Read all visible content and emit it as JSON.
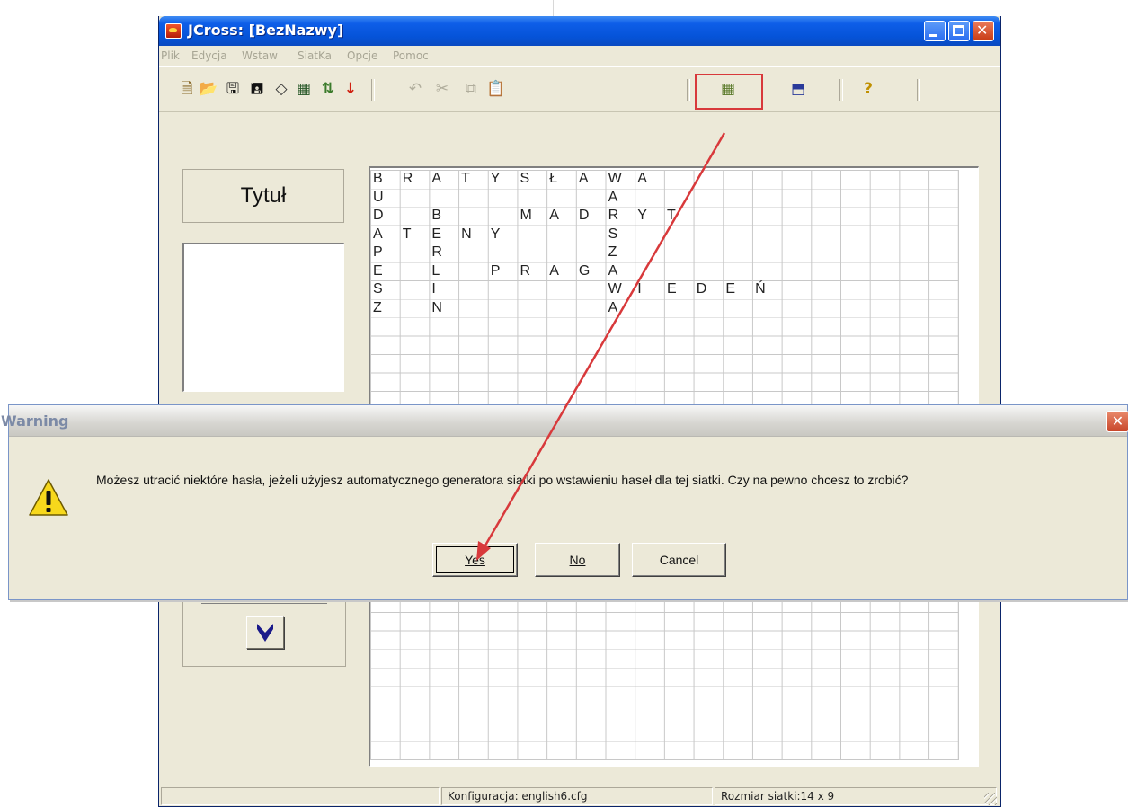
{
  "window": {
    "title": "JCross: [BezNazwy]"
  },
  "menu": {
    "items": [
      "Plik",
      "Edycja",
      "Wstaw",
      "SiatKa",
      "Opcje",
      "Pomoc"
    ]
  },
  "toolbar": {
    "buttons": [
      {
        "name": "new-icon",
        "glyph": "🗎"
      },
      {
        "name": "open-icon",
        "glyph": "📂"
      },
      {
        "name": "save-icon",
        "glyph": "🖫"
      },
      {
        "name": "save-as-icon",
        "glyph": "🖪"
      },
      {
        "name": "eraser-icon",
        "glyph": "◇"
      },
      {
        "name": "pattern-icon",
        "glyph": "▦"
      },
      {
        "name": "sort-icon",
        "glyph": "⇅"
      },
      {
        "name": "down-arrow-icon",
        "glyph": "↓"
      },
      {
        "name": "undo-icon",
        "glyph": "↶"
      },
      {
        "name": "cut-icon",
        "glyph": "✂"
      },
      {
        "name": "copy-icon",
        "glyph": "⧉"
      },
      {
        "name": "paste-icon",
        "glyph": "📋"
      },
      {
        "name": "grid-generator-icon",
        "glyph": "▦"
      },
      {
        "name": "export-icon",
        "glyph": "⬒"
      },
      {
        "name": "help-icon",
        "glyph": "?"
      }
    ]
  },
  "left_panel": {
    "title_label": "Tytuł"
  },
  "grid": {
    "rows": [
      [
        "B",
        "R",
        "A",
        "T",
        "Y",
        "S",
        "Ł",
        "A",
        "W",
        "A",
        "",
        "",
        "",
        "",
        "",
        "",
        "",
        "",
        "",
        ""
      ],
      [
        "U",
        "",
        "",
        "",
        "",
        "",
        "",
        "",
        "A",
        "",
        "",
        "",
        "",
        "",
        "",
        "",
        "",
        "",
        "",
        ""
      ],
      [
        "D",
        "",
        "B",
        "",
        "",
        "M",
        "A",
        "D",
        "R",
        "Y",
        "T",
        "",
        "",
        "",
        "",
        "",
        "",
        "",
        "",
        ""
      ],
      [
        "A",
        "T",
        "E",
        "N",
        "Y",
        "",
        "",
        "",
        "S",
        "",
        "",
        "",
        "",
        "",
        "",
        "",
        "",
        "",
        "",
        ""
      ],
      [
        "P",
        "",
        "R",
        "",
        "",
        "",
        "",
        "",
        "Z",
        "",
        "",
        "",
        "",
        "",
        "",
        "",
        "",
        "",
        "",
        ""
      ],
      [
        "E",
        "",
        "L",
        "",
        "P",
        "R",
        "A",
        "G",
        "A",
        "",
        "",
        "",
        "",
        "",
        "",
        "",
        "",
        "",
        "",
        ""
      ],
      [
        "S",
        "",
        "I",
        "",
        "",
        "",
        "",
        "",
        "W",
        "I",
        "E",
        "D",
        "E",
        "Ń",
        "",
        "",
        "",
        "",
        "",
        ""
      ],
      [
        "Z",
        "",
        "N",
        "",
        "",
        "",
        "",
        "",
        "A",
        "",
        "",
        "",
        "",
        "",
        "",
        "",
        "",
        "",
        "",
        ""
      ]
    ]
  },
  "status": {
    "config": "Konfiguracja: english6.cfg",
    "size": "Rozmiar siatki:14 x 9"
  },
  "dialog": {
    "title": "Warning",
    "message": "Możesz utracić niektóre hasła, jeżeli użyjesz automatycznego generatora siatki po wstawieniu haseł dla tej siatki. Czy na pewno chcesz to zrobić?",
    "yes_label": "Yes",
    "no_label": "No",
    "cancel_label": "Cancel"
  },
  "annotation": {
    "highlight_color": "#d8393b",
    "arrow_color": "#d8393b"
  }
}
